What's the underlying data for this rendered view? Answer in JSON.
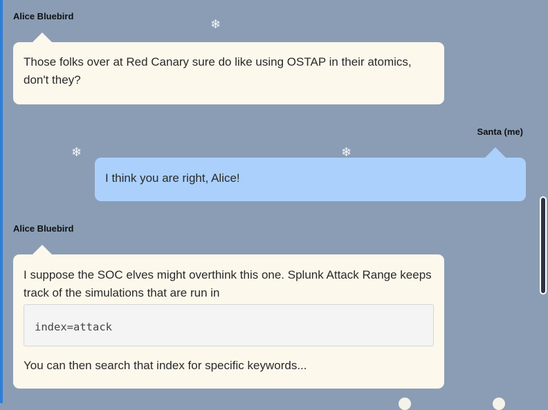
{
  "messages": [
    {
      "sender": "Alice Bluebird",
      "text": "Those folks over at Red Canary sure do like using OSTAP in their atomics, don't they?"
    },
    {
      "sender": "Santa (me)",
      "text": "I think you are right, Alice!"
    },
    {
      "sender": "Alice Bluebird",
      "text": "I suppose the SOC elves might overthink this one. Splunk Attack Range keeps track of the simulations that are run in",
      "code": "index=attack",
      "text_after": "You can then search that index for specific keywords..."
    }
  ],
  "decorations": {
    "snowflake_glyph": "❄"
  },
  "colors": {
    "background": "#8a9db5",
    "alice_bubble": "#fdf8ec",
    "me_bubble": "#abd0fb",
    "accent": "#2f7fd6"
  }
}
